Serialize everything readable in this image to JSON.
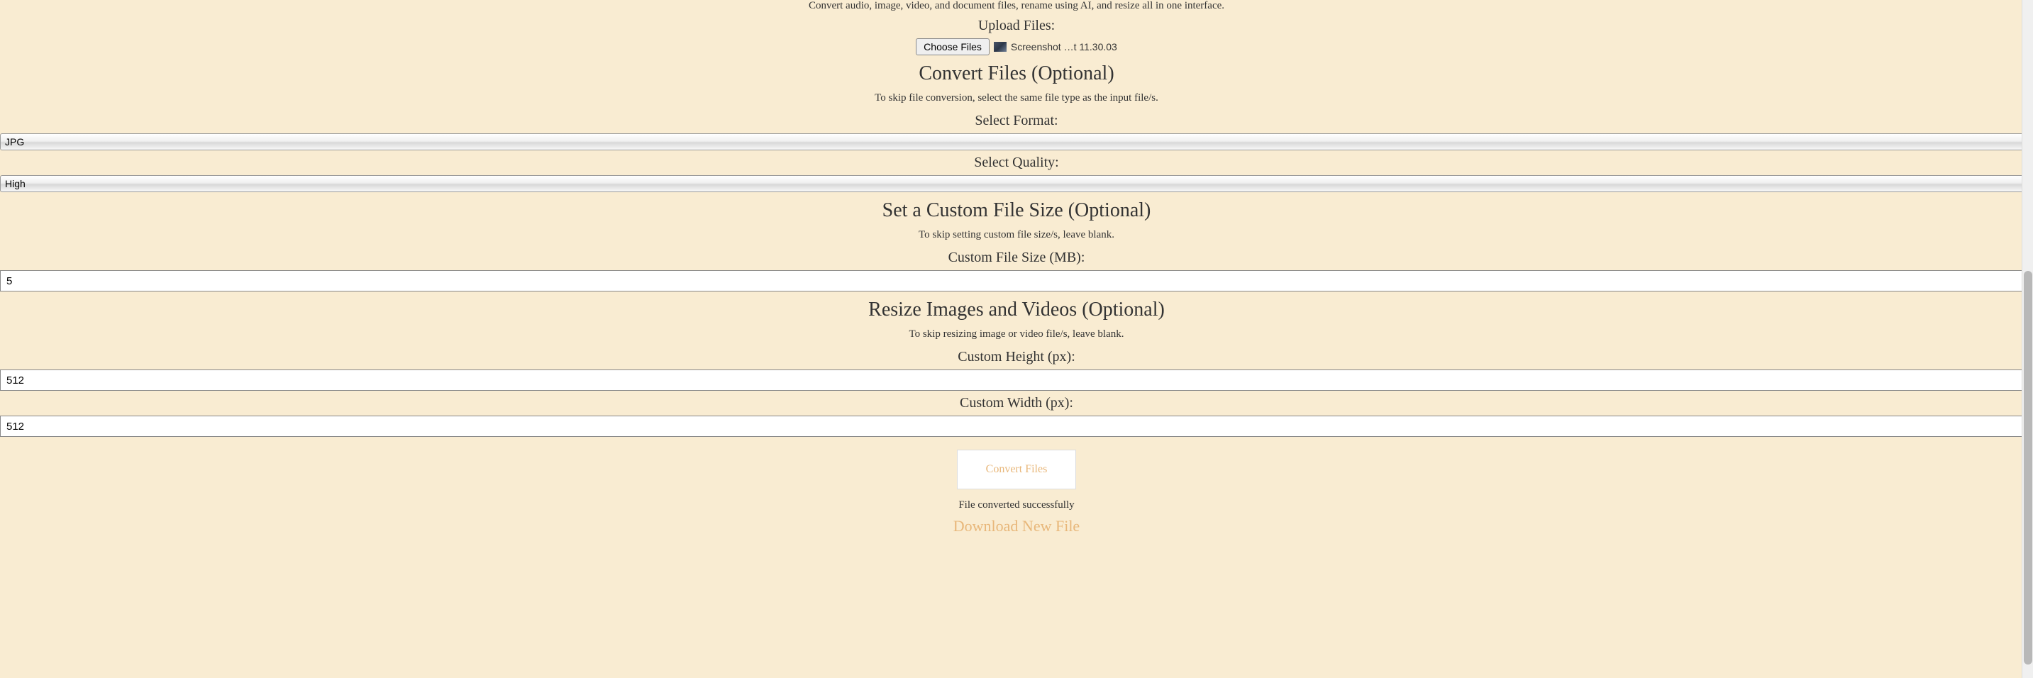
{
  "intro": "Convert audio, image, video, and document files, rename using AI, and resize all in one interface.",
  "upload": {
    "label": "Upload Files:",
    "button": "Choose Files",
    "filename": "Screenshot …t 11.30.03"
  },
  "convert": {
    "title": "Convert Files (Optional)",
    "hint": "To skip file conversion, select the same file type as the input file/s.",
    "format_label": "Select Format:",
    "format_value": "JPG",
    "quality_label": "Select Quality:",
    "quality_value": "High"
  },
  "custom_size": {
    "title": "Set a Custom File Size (Optional)",
    "hint": "To skip setting custom file size/s, leave blank.",
    "label": "Custom File Size (MB):",
    "value": "5"
  },
  "resize": {
    "title": "Resize Images and Videos (Optional)",
    "hint": "To skip resizing image or video file/s, leave blank.",
    "height_label": "Custom Height (px):",
    "height_value": "512",
    "width_label": "Custom Width (px):",
    "width_value": "512"
  },
  "actions": {
    "convert_button": "Convert Files",
    "status": "File converted successfully",
    "download": "Download New File"
  }
}
